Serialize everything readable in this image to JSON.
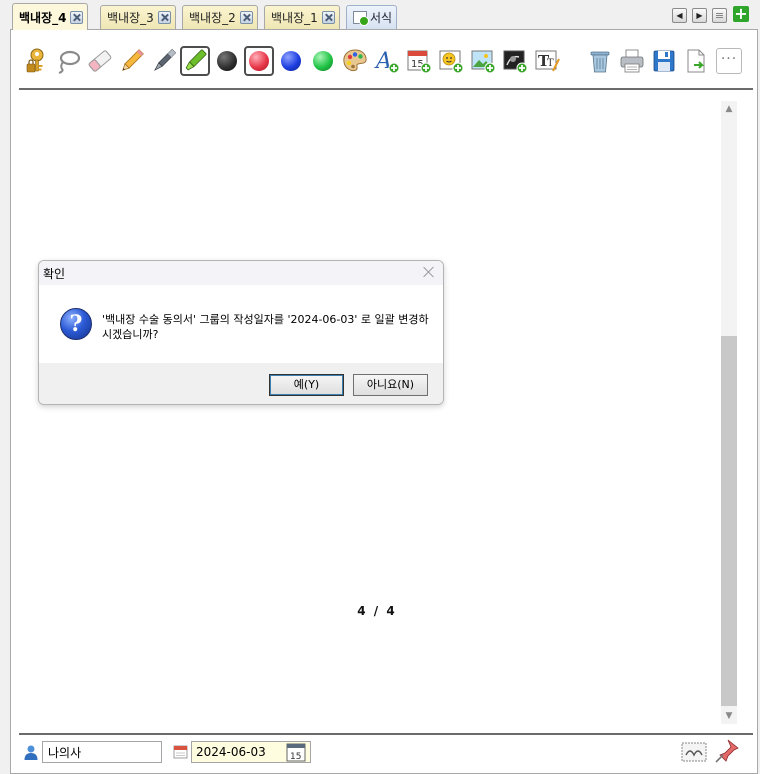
{
  "tabs": [
    {
      "label": "백내장_4",
      "active": true
    },
    {
      "label": "백내장_3",
      "active": false
    },
    {
      "label": "백내장_2",
      "active": false
    },
    {
      "label": "백내장_1",
      "active": false
    }
  ],
  "form_tab": {
    "label": "서식"
  },
  "tab_controls": {
    "prev": "◀",
    "next": "▶",
    "list": "≡",
    "add": "+"
  },
  "toolbar": {
    "more_label": "···",
    "tools": [
      {
        "name": "key-lock-icon"
      },
      {
        "name": "lasso-icon"
      },
      {
        "name": "eraser-icon"
      },
      {
        "name": "pencil-icon"
      },
      {
        "name": "pen-icon"
      },
      {
        "name": "highlighter-icon",
        "selected": true
      },
      {
        "name": "color-black-icon",
        "color": "#2b2b2b"
      },
      {
        "name": "color-red-icon",
        "color": "#e8384a",
        "selected": true
      },
      {
        "name": "color-blue-icon",
        "color": "#1e3fe0"
      },
      {
        "name": "color-green-icon",
        "color": "#21c446"
      },
      {
        "name": "palette-icon"
      },
      {
        "name": "add-text-icon"
      },
      {
        "name": "add-date-icon"
      },
      {
        "name": "add-emoji-icon"
      },
      {
        "name": "add-image-icon"
      },
      {
        "name": "add-photo-icon"
      },
      {
        "name": "text-style-icon"
      },
      {
        "name": "trash-icon"
      },
      {
        "name": "print-icon"
      },
      {
        "name": "save-icon"
      },
      {
        "name": "export-icon"
      }
    ]
  },
  "page_indicator": {
    "current": "4",
    "separator": "/",
    "total": "4"
  },
  "dialog": {
    "title": "확인",
    "message": "'백내장 수술 동의서' 그룹의 작성일자를 '2024-06-03' 로 일괄 변경하시겠습니까?",
    "yes_label": "예(Y)",
    "no_label": "아니요(N)"
  },
  "status": {
    "user_name": "나의사",
    "date": "2024-06-03",
    "calendar_day": "15"
  }
}
